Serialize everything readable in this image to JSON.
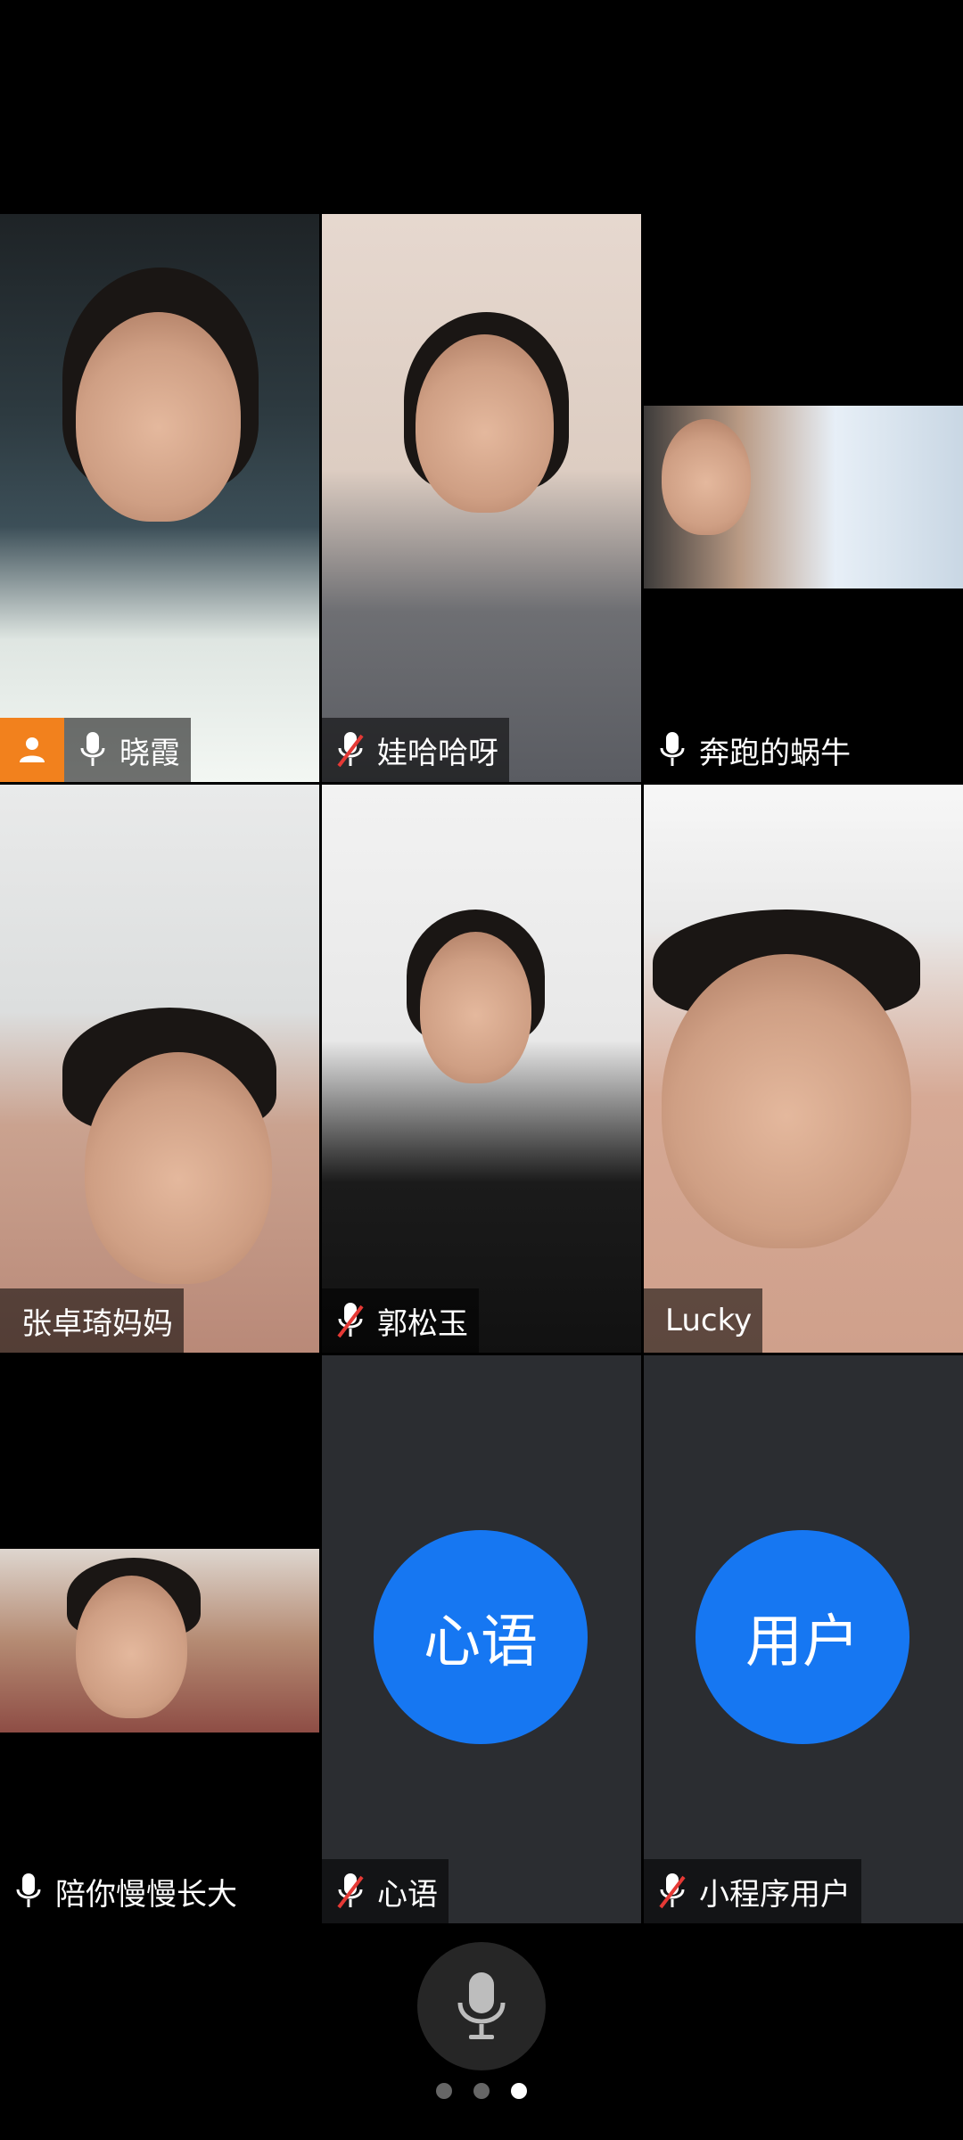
{
  "participants": [
    {
      "name": "晓霞",
      "mic": "on",
      "host": true
    },
    {
      "name": "娃哈哈呀",
      "mic": "muted"
    },
    {
      "name": "奔跑的蜗牛",
      "mic": "on"
    },
    {
      "name": "张卓琦妈妈",
      "mic": "none"
    },
    {
      "name": "郭松玉",
      "mic": "muted"
    },
    {
      "name": "Lucky",
      "mic": "none"
    },
    {
      "name": "陪你慢慢长大",
      "mic": "on"
    },
    {
      "name": "心语",
      "mic": "muted",
      "avatar_text": "心语"
    },
    {
      "name": "小程序用户",
      "mic": "muted",
      "avatar_text": "用户"
    }
  ],
  "colors": {
    "avatar_bg": "#1677f2",
    "host_badge": "#f2811d",
    "tile_dark": "#2b2d31"
  },
  "pager": {
    "pages": 3,
    "current": 3
  },
  "icons": {
    "mic": "microphone-icon",
    "mic_muted": "microphone-muted-icon",
    "host": "person-icon"
  }
}
